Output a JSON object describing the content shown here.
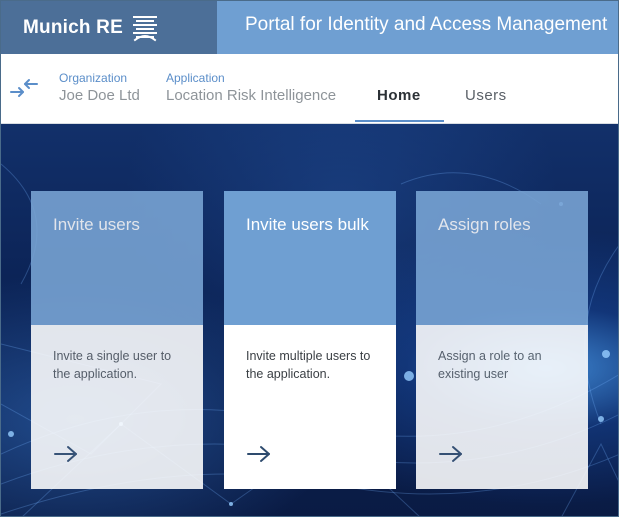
{
  "header": {
    "brand": "Munich RE",
    "title": "Portal for Identity and Access Management"
  },
  "context": {
    "organization": {
      "label": "Organization",
      "value": "Joe Doe Ltd"
    },
    "application": {
      "label": "Application",
      "value": "Location Risk Intelligence"
    }
  },
  "nav": {
    "tabs": [
      {
        "label": "Home",
        "active": true
      },
      {
        "label": "Users",
        "active": false
      }
    ]
  },
  "cards": [
    {
      "title": "Invite users",
      "description": "Invite a single user to the application.",
      "state": "dimmed"
    },
    {
      "title": "Invite users bulk",
      "description": "Invite multiple users to the application.",
      "state": "highlighted"
    },
    {
      "title": "Assign roles",
      "description": "Assign a role to an existing user",
      "state": "dimmed"
    }
  ],
  "colors": {
    "brand_dark": "#4c6f98",
    "brand_light": "#6f9fd2",
    "accent": "#5b8ec9",
    "hero_bg": "#0b2254"
  }
}
